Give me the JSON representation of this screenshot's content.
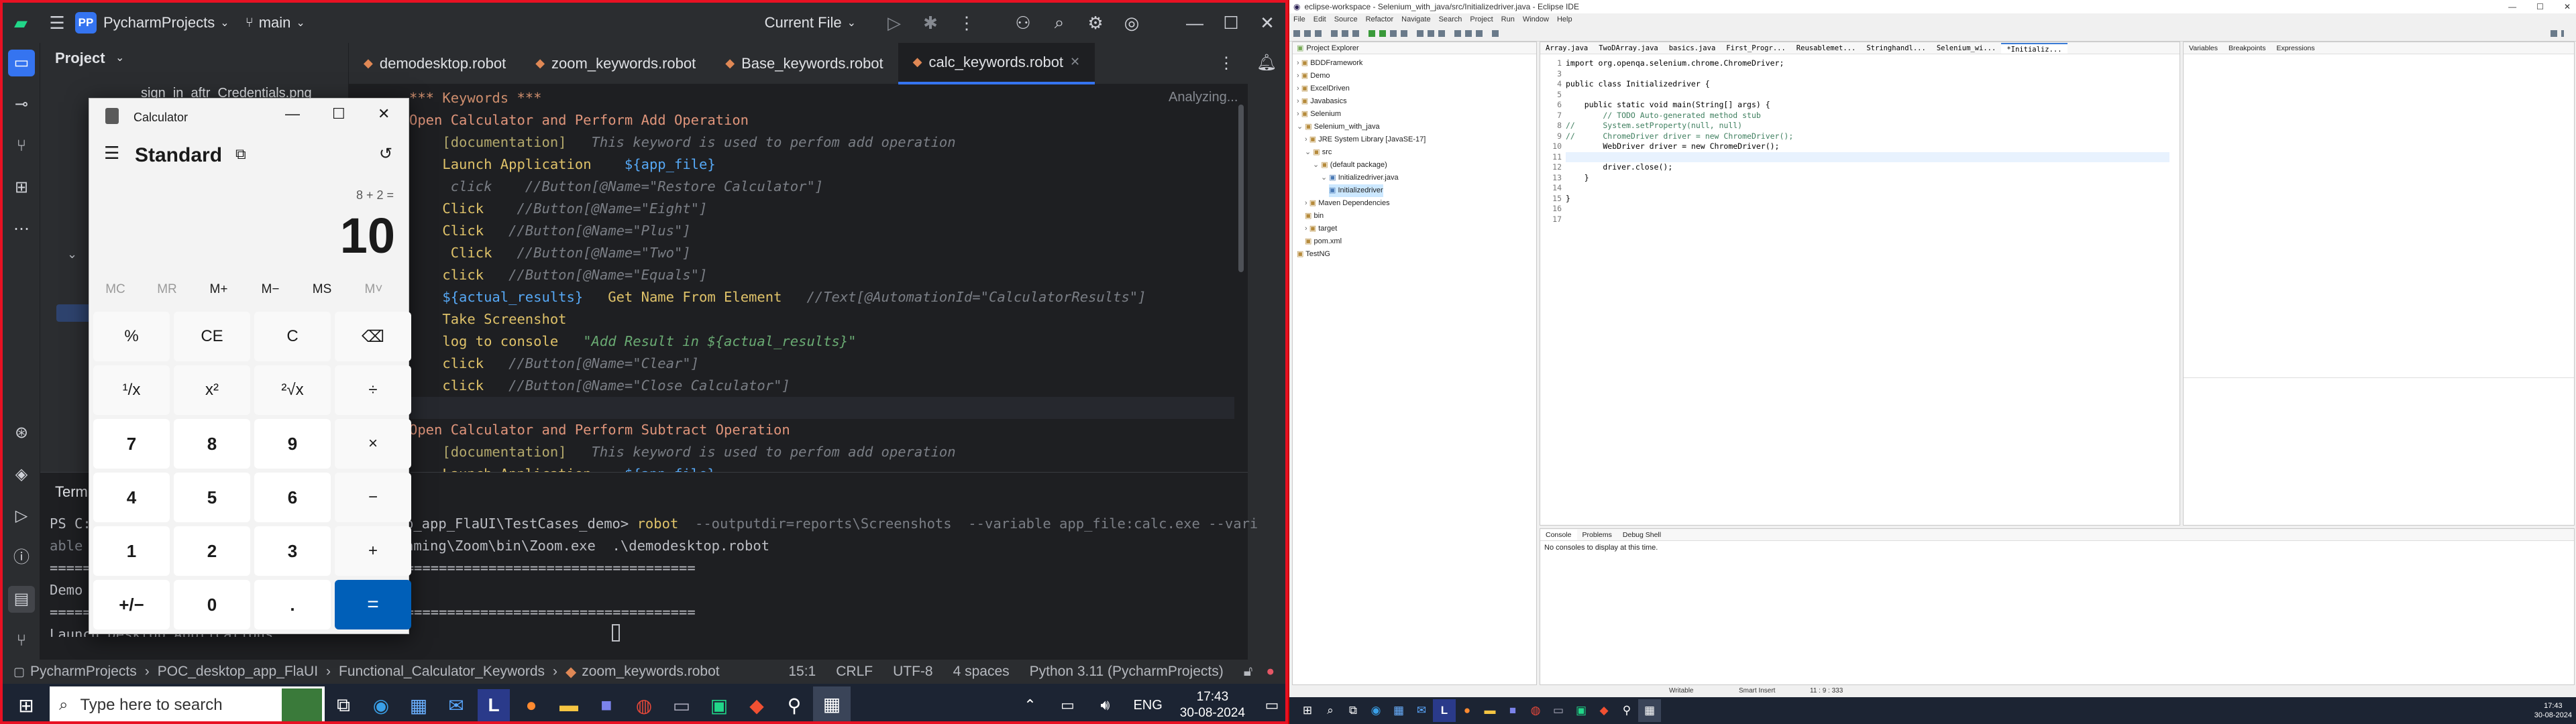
{
  "pycharm": {
    "project_badge": "PP",
    "project_name": "PycharmProjects",
    "branch": "main",
    "run_config": "Current File",
    "project_panel_title": "Project",
    "project_file_partial": "sign_in_aftr_Credentials.png",
    "tabs": [
      {
        "label": "demodesktop.robot"
      },
      {
        "label": "zoom_keywords.robot"
      },
      {
        "label": "Base_keywords.robot"
      },
      {
        "label": "calc_keywords.robot"
      }
    ],
    "analyzing": "Analyzing...",
    "code": {
      "l1": "*** Keywords ***",
      "l2": "Open Calculator and Perform Add Operation",
      "l3_doc": "[documentation]",
      "l3_text": "This keyword is used to perfom add operation",
      "l4_kw": "Launch Application",
      "l4_var": "${app_file}",
      "l5_kw": "click",
      "l5_cm": "//Button[@Name=\"Restore Calculator\"]",
      "l6_kw": "Click",
      "l6_cm": "//Button[@Name=\"Eight\"]",
      "l7_kw": "Click",
      "l7_cm": "//Button[@Name=\"Plus\"]",
      "l8_kw": "Click",
      "l8_cm": "//Button[@Name=\"Two\"]",
      "l9_kw": "click",
      "l9_cm": "//Button[@Name=\"Equals\"]",
      "l10_var": "${actual_results}",
      "l10_kw": "Get Name From Element",
      "l10_cm": "//Text[@AutomationId=\"CalculatorResults\"]",
      "l11": "Take Screenshot",
      "l12_kw": "log to console",
      "l12_str": "\"Add Result in ${actual_results}\"",
      "l13_kw": "click",
      "l13_cm": "//Button[@Name=\"Clear\"]",
      "l14_kw": "click",
      "l14_cm": "//Button[@Name=\"Close Calculator\"]",
      "l16": "Open Calculator and Perform Subtract Operation",
      "l17_doc": "[documentation]",
      "l17_text": "This keyword is used to perfom add operation",
      "l18_kw": "Launch Application",
      "l18_var": "${app_file}"
    },
    "terminal": {
      "tab": "Terminal",
      "prompt": "PS C:",
      "cmd_path": "p_app_FlaUI\\TestCases_demo>",
      "cmd": "robot",
      "cmd_args": "--outputdir=reports\\Screenshots  --variable app_file:calc.exe --vari",
      "l2_pre": "able",
      "l2": "aming\\Zoom\\bin\\Zoom.exe  .\\demodesktop.robot",
      "sep": "==============================================================================",
      "demo": "Demo",
      "launch": "Launch Desktop Applications"
    },
    "status": {
      "crumbs": [
        "PycharmProjects",
        "POC_desktop_app_FlaUI",
        "Functional_Calculator_Keywords",
        "zoom_keywords.robot"
      ],
      "position": "15:1",
      "line_sep": "CRLF",
      "encoding": "UTF-8",
      "indent": "4 spaces",
      "interpreter": "Python 3.11 (PycharmProjects)"
    }
  },
  "calculator": {
    "title": "Calculator",
    "mode": "Standard",
    "expression": "8 + 2 =",
    "result": "10",
    "memory": [
      "MC",
      "MR",
      "M+",
      "M−",
      "MS",
      "M˅"
    ],
    "buttons": [
      [
        "%",
        "CE",
        "C",
        "⌫"
      ],
      [
        "¹/x",
        "x²",
        "²√x",
        "÷"
      ],
      [
        "7",
        "8",
        "9",
        "×"
      ],
      [
        "4",
        "5",
        "6",
        "−"
      ],
      [
        "1",
        "2",
        "3",
        "+"
      ],
      [
        "+/−",
        "0",
        ".",
        "="
      ]
    ]
  },
  "taskbar_left": {
    "search_placeholder": "Type here to search",
    "lang": "ENG",
    "time": "17:43",
    "date": "30-08-2024"
  },
  "eclipse": {
    "title": "eclipse-workspace - Selenium_with_java/src/Initializedriver.java - Eclipse IDE",
    "menu": [
      "File",
      "Edit",
      "Source",
      "Refactor",
      "Navigate",
      "Search",
      "Project",
      "Run",
      "Window",
      "Help"
    ],
    "pe_title": "Project Explorer",
    "pe_items": [
      "BDDFramework",
      "Demo",
      "ExcelDriven",
      "Javabasics",
      "Selenium",
      "Selenium_with_java",
      "JRE System Library [JavaSE-17]",
      "src",
      "(default package)",
      "Initializedriver.java",
      "Initializedriver",
      "Maven Dependencies",
      "bin",
      "target",
      "pom.xml",
      "TestNG"
    ],
    "editor_tabs": [
      "Array.java",
      "TwoDArray.java",
      "basics.java",
      "First_Progr...",
      "Reusablemet...",
      "Stringhandl...",
      "Selenium_wi...",
      "*Initializ..."
    ],
    "code": [
      "import org.openqa.selenium.chrome.ChromeDriver;",
      "",
      "public class Initializedriver {",
      "",
      "    public static void main(String[] args) {",
      "        // TODO Auto-generated method stub",
      "//      System.setProperty(null, null)",
      "//      ChromeDriver driver = new ChromeDriver();",
      "        WebDriver driver = new ChromeDriver();",
      "",
      "        driver.close();",
      "    }",
      "",
      "}",
      ""
    ],
    "line_numbers": [
      "1",
      "3",
      "4",
      "5",
      "6",
      "7",
      "8",
      "9",
      "10",
      "11",
      "12",
      "13",
      "14",
      "15",
      "16",
      "17"
    ],
    "right_tabs": [
      "Variables",
      "Breakpoints",
      "Expressions"
    ],
    "console_tabs": [
      "Console",
      "Problems",
      "Debug Shell"
    ],
    "console_msg": "No consoles to display at this time.",
    "status_writable": "Writable",
    "status_insert": "Smart Insert",
    "status_pos": "11 : 9 : 333"
  },
  "taskbar_right": {
    "time": "17:43",
    "date": "30-08-2024"
  }
}
